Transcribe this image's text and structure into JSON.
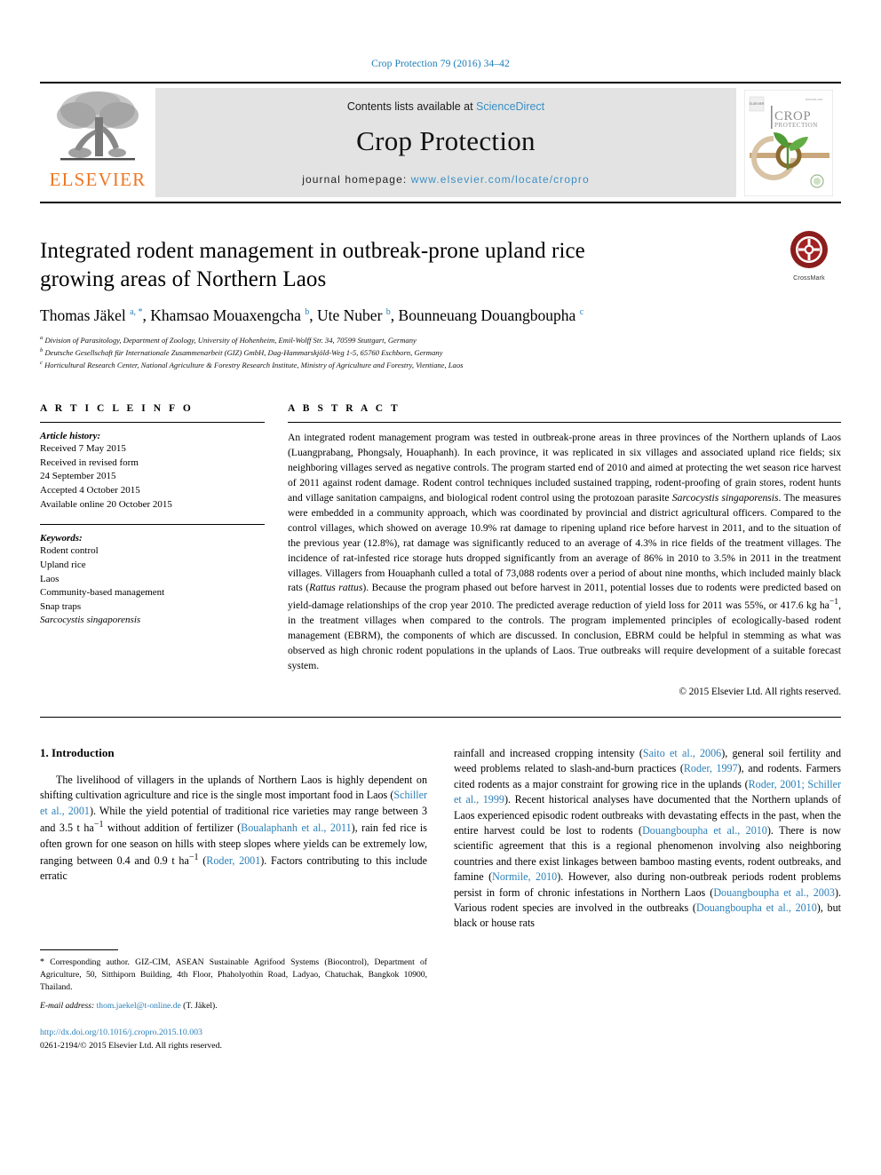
{
  "running_head": "Crop Protection 79 (2016) 34–42",
  "masthead": {
    "publisher_logo_name": "elsevier-logo",
    "publisher_wordmark": "ELSEVIER",
    "contents_prefix": "Contents lists available at ",
    "contents_link": "ScienceDirect",
    "journal_title": "Crop Protection",
    "homepage_prefix": "journal homepage: ",
    "homepage_link": "www.elsevier.com/locate/cropro",
    "cover_title_line1": "CROP",
    "cover_title_line2": "PROTECTION"
  },
  "article": {
    "title": "Integrated rodent management in outbreak-prone upland rice growing areas of Northern Laos",
    "authors_html": "Thomas Jäkel <sup>a, *</sup>, Khamsao Mouaxengcha <sup>b</sup>, Ute Nuber <sup>b</sup>, Bounneuang Douangboupha <sup>c</sup>",
    "affiliations": [
      "a Division of Parasitology, Department of Zoology, University of Hohenheim, Emil-Wolff Str. 34, 70599 Stuttgart, Germany",
      "b Deutsche Gesellschaft für Internationale Zusammenarbeit (GIZ) GmbH, Dag-Hammarskjöld-Weg 1-5, 65760 Eschborn, Germany",
      "c Horticultural Research Center, National Agriculture & Forestry Research Institute, Ministry of Agriculture and Forestry, Vientiane, Laos"
    ],
    "crossmark_label": "CrossMark"
  },
  "article_info": {
    "heading": "A R T I C L E   I N F O",
    "history_label": "Article history:",
    "history": [
      "Received 7 May 2015",
      "Received in revised form",
      "24 September 2015",
      "Accepted 4 October 2015",
      "Available online 20 October 2015"
    ],
    "keywords_label": "Keywords:",
    "keywords": [
      "Rodent control",
      "Upland rice",
      "Laos",
      "Community-based management",
      "Snap traps",
      "Sarcocystis singaporensis"
    ],
    "keywords_italic_index": 5
  },
  "abstract": {
    "heading": "A B S T R A C T",
    "text_html": "An integrated rodent management program was tested in outbreak-prone areas in three provinces of the Northern uplands of Laos (Luangprabang, Phongsaly, Houaphanh). In each province, it was replicated in six villages and associated upland rice fields; six neighboring villages served as negative controls. The program started end of 2010 and aimed at protecting the wet season rice harvest of 2011 against rodent damage. Rodent control techniques included sustained trapping, rodent-proofing of grain stores, rodent hunts and village sanitation campaigns, and biological rodent control using the protozoan parasite <i>Sarcocystis singaporensis</i>. The measures were embedded in a community approach, which was coordinated by provincial and district agricultural officers. Compared to the control villages, which showed on average 10.9% rat damage to ripening upland rice before harvest in 2011, and to the situation of the previous year (12.8%), rat damage was significantly reduced to an average of 4.3% in rice fields of the treatment villages. The incidence of rat-infested rice storage huts dropped significantly from an average of 86% in 2010 to 3.5% in 2011 in the treatment villages. Villagers from Houaphanh culled a total of 73,088 rodents over a period of about nine months, which included mainly black rats (<i>Rattus rattus</i>). Because the program phased out before harvest in 2011, potential losses due to rodents were predicted based on yield-damage relationships of the crop year 2010. The predicted average reduction of yield loss for 2011 was 55%, or 417.6 kg ha<sup>−1</sup>, in the treatment villages when compared to the controls. The program implemented principles of ecologically-based rodent management (EBRM), the components of which are discussed. In conclusion, EBRM could be helpful in stemming as what was observed as high chronic rodent populations in the uplands of Laos. True outbreaks will require development of a suitable forecast system.",
    "copyright": "© 2015 Elsevier Ltd. All rights reserved."
  },
  "introduction": {
    "heading": "1. Introduction",
    "left_paragraph_html": "The livelihood of villagers in the uplands of Northern Laos is highly dependent on shifting cultivation agriculture and rice is the single most important food in Laos (<a class=\"ref\" href=\"#\">Schiller et al., 2001</a>). While the yield potential of traditional rice varieties may range between 3 and 3.5 t ha<sup>−1</sup> without addition of fertilizer (<a class=\"ref\" href=\"#\">Boualaphanh et al., 2011</a>), rain fed rice is often grown for one season on hills with steep slopes where yields can be extremely low, ranging between 0.4 and 0.9 t ha<sup>−1</sup> (<a class=\"ref\" href=\"#\">Roder, 2001</a>). Factors contributing to this include erratic",
    "right_paragraph_html": "rainfall and increased cropping intensity (<a class=\"ref\" href=\"#\">Saito et al., 2006</a>), general soil fertility and weed problems related to slash-and-burn practices (<a class=\"ref\" href=\"#\">Roder, 1997</a>), and rodents. Farmers cited rodents as a major constraint for growing rice in the uplands (<a class=\"ref\" href=\"#\">Roder, 2001; Schiller et al., 1999</a>). Recent historical analyses have documented that the Northern uplands of Laos experienced episodic rodent outbreaks with devastating effects in the past, when the entire harvest could be lost to rodents (<a class=\"ref\" href=\"#\">Douangboupha et al., 2010</a>). There is now scientific agreement that this is a regional phenomenon involving also neighboring countries and there exist linkages between bamboo masting events, rodent outbreaks, and famine (<a class=\"ref\" href=\"#\">Normile, 2010</a>). However, also during non-outbreak periods rodent problems persist in form of chronic infestations in Northern Laos (<a class=\"ref\" href=\"#\">Douangboupha et al., 2003</a>). Various rodent species are involved in the outbreaks (<a class=\"ref\" href=\"#\">Douangboupha et al., 2010</a>), but black or house rats"
  },
  "footer": {
    "corresponding_html": "<span class=\"fnstar\">*</span> Corresponding author. GIZ-CIM, ASEAN Sustainable Agrifood Systems (Biocontrol), Department of Agriculture, 50, Sitthiporn Building, 4th Floor, Phaholyothin Road, Ladyao, Chatuchak, Bangkok 10900, Thailand.",
    "email_label": "E-mail address:",
    "email": "thom.jaekel@t-online.de",
    "email_suffix": "(T. Jäkel).",
    "doi": "http://dx.doi.org/10.1016/j.cropro.2015.10.003",
    "issn_line": "0261-2194/© 2015 Elsevier Ltd. All rights reserved."
  },
  "colors": {
    "link_blue": "#2a7fb8",
    "elsevier_orange": "#ee7623",
    "banner_gray": "#e3e3e3"
  }
}
